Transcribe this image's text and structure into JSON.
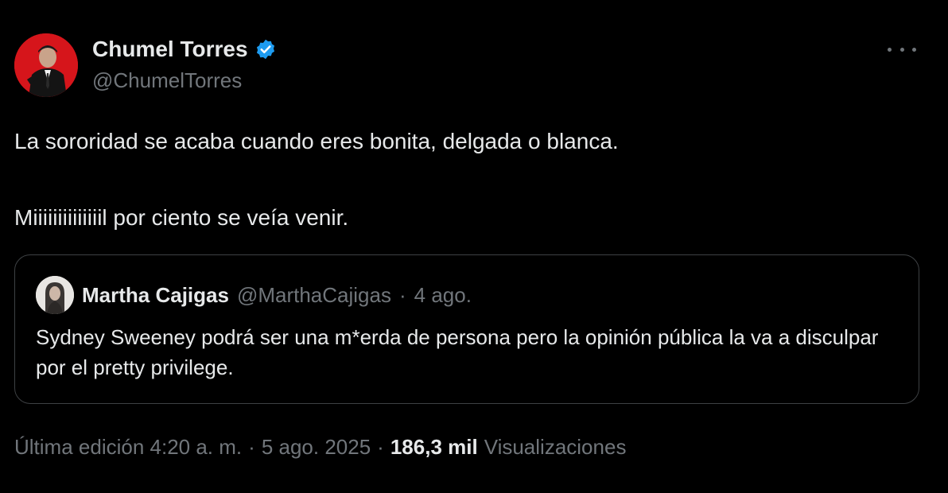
{
  "author": {
    "display_name": "Chumel Torres",
    "handle": "@ChumelTorres",
    "verified": true
  },
  "tweet": {
    "line1": "La sororidad se acaba cuando eres bonita, delgada o blanca.",
    "line2": "Miiiiiiiiiiiiiil por ciento se veía venir."
  },
  "quoted": {
    "display_name": "Martha Cajigas",
    "handle": "@MarthaCajigas",
    "separator": "·",
    "date": "4 ago.",
    "text": "Sydney Sweeney podrá ser una m*erda de persona pero la opinión pública la va a disculpar por el pretty privilege."
  },
  "meta": {
    "edited_label": "Última edición 4:20 a. m.",
    "separator": "·",
    "date": "5 ago. 2025",
    "separator2": "·",
    "views_count": "186,3 mil",
    "views_label": "Visualizaciones"
  },
  "icons": {
    "verified": "verified-badge-icon",
    "more": "more-options-icon"
  },
  "colors": {
    "background": "#000000",
    "text": "#e7e9ea",
    "secondary": "#71767b",
    "verified": "#1d9bf0",
    "border": "#3e4144"
  }
}
